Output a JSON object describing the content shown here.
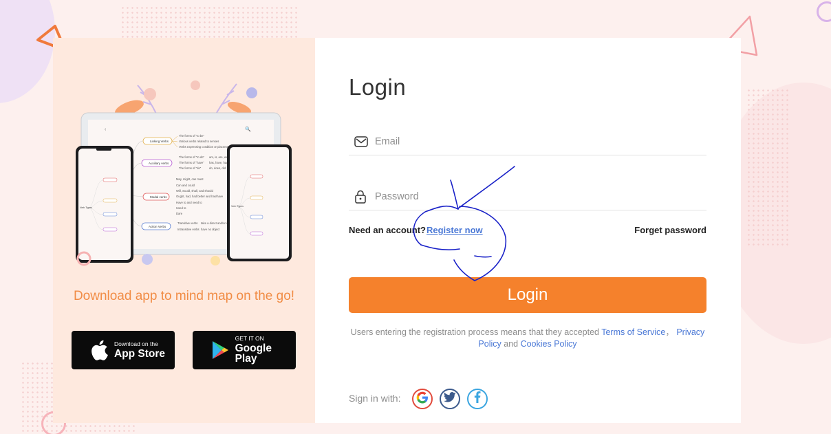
{
  "left_panel": {
    "tagline": "Download app to mind map on the go!",
    "app_store": {
      "small": "Download on the",
      "big": "App Store"
    },
    "google_play": {
      "small": "GET IT ON",
      "big": "Google Play"
    },
    "mockup": {
      "tablet_nodes": [
        "Linking Verbs",
        "Auxiliary verbs",
        "Modal verbs",
        "Action Verbs"
      ],
      "tablet_leaves": [
        "The forms of \"to be\"",
        "Various verbs related to senses",
        "Verbs expressing condition or placement of a",
        "The forms of \"to do\"",
        "The forms of \"have\"",
        "The forms of \"do\"",
        "May, might, can must",
        "Can and could",
        "Will, would, shall, and should",
        "Ought, had, had better and has/have",
        "Have to and need to",
        "Used to",
        "Dare",
        "Transitive verbs",
        "Intransitive verbs"
      ],
      "tablet_leaf_extras": [
        "am, is, are, was",
        "has, have, had",
        "do, does, did",
        "take a direct and/or indirect",
        "have no object"
      ],
      "phone_root": "Verb Types"
    }
  },
  "login": {
    "title": "Login",
    "email_placeholder": "Email",
    "password_placeholder": "Password",
    "need_account": "Need an account?",
    "register": "Register now",
    "forget": "Forget password",
    "button": "Login",
    "terms_prefix": "Users entering the registration process means that they accepted ",
    "terms_of_service": "Terms of Service",
    "terms_sep": "，",
    "privacy_policy": "Privacy Policy",
    "terms_and": " and ",
    "cookies_policy": "Cookies Policy",
    "signin_with": "Sign in with:"
  },
  "colors": {
    "accent": "#f5812c",
    "link": "#4a78d6",
    "tagline": "#f18c45",
    "left_card_bg": "#fee9de",
    "annotation": "#1a22c8"
  },
  "icons": [
    "mail-icon",
    "lock-icon",
    "apple-icon",
    "google-play-icon",
    "google-icon",
    "twitter-icon",
    "facebook-icon"
  ]
}
